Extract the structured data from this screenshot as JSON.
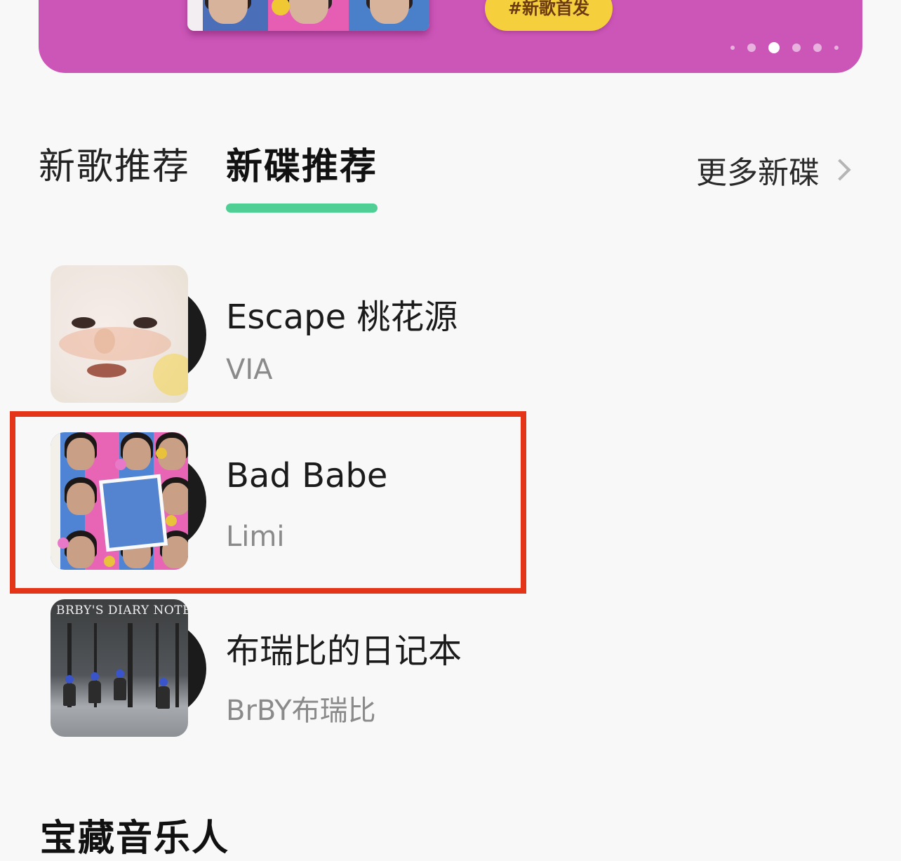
{
  "banner": {
    "tag_label": "#新歌首发",
    "carousel_total": 6,
    "carousel_active_index": 2
  },
  "tabs": [
    {
      "label": "新歌推荐",
      "active": false
    },
    {
      "label": "新碟推荐",
      "active": true
    }
  ],
  "more_link": {
    "label": "更多新碟"
  },
  "albums": [
    {
      "title": "Escape 桃花源",
      "artist": "VIA"
    },
    {
      "title": "Bad Babe",
      "artist": "Limi",
      "highlighted": true
    },
    {
      "title": "布瑞比的日记本",
      "artist": "BrBY布瑞比",
      "cover_text": "BRBY'S DIARY NOTE"
    }
  ],
  "next_section": {
    "title": "宝藏音乐人"
  },
  "colors": {
    "banner": "#cc56b8",
    "tab_indicator": "#4fcf94",
    "highlight_box": "#e43518",
    "banner_tag": "#f6cf3c"
  }
}
